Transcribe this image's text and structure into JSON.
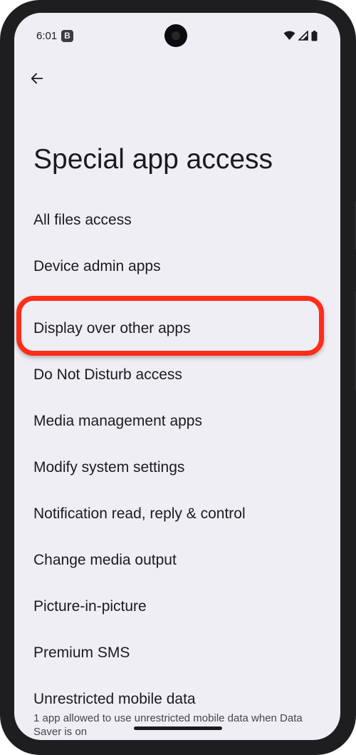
{
  "status_bar": {
    "time": "6:01",
    "badge": "B",
    "icons": [
      "wifi-icon",
      "signal-icon",
      "battery-icon"
    ]
  },
  "header": {
    "back_icon": "arrow-back-icon",
    "title": "Special app access"
  },
  "items": [
    {
      "label": "All files access"
    },
    {
      "label": "Device admin apps"
    },
    {
      "label": "Display over other apps",
      "highlighted": true
    },
    {
      "label": "Do Not Disturb access"
    },
    {
      "label": "Media management apps"
    },
    {
      "label": "Modify system settings"
    },
    {
      "label": "Notification read, reply & control"
    },
    {
      "label": "Change media output"
    },
    {
      "label": "Picture-in-picture"
    },
    {
      "label": "Premium SMS"
    },
    {
      "label": "Unrestricted mobile data",
      "summary": "1 app allowed to use unrestricted mobile data when Data Saver is on"
    }
  ],
  "colors": {
    "background": "#efeef4",
    "text": "#1b1b1f",
    "highlight": "#ff2d1a"
  }
}
